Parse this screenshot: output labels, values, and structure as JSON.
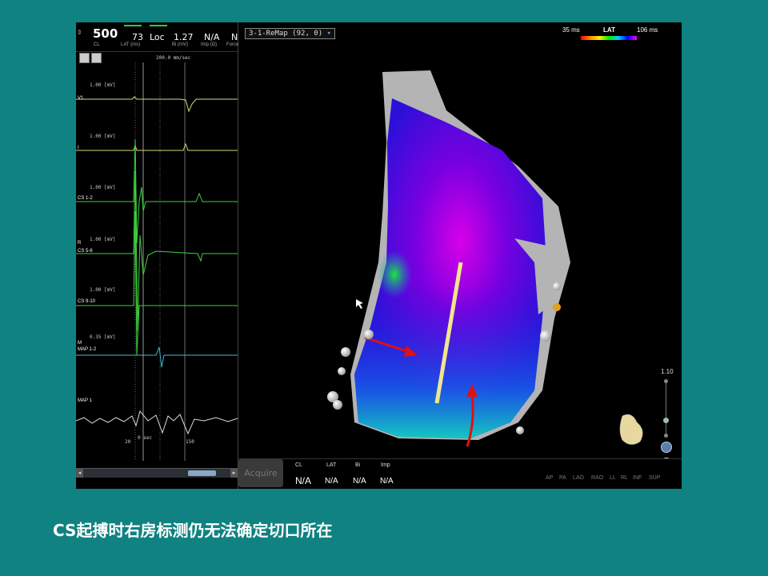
{
  "status_bar": {
    "cl_value": "500",
    "cl_label": "CL",
    "lat_value": "73",
    "lat_label": "LAT (ms)",
    "loc_label": "Loc",
    "bi_value": "1.27",
    "bi_label": "Bi (mV)",
    "imp_value": "N/A",
    "imp_label": "Imp (Ω)",
    "force_value": "N",
    "force_label": "Force"
  },
  "ecg": {
    "sweep_speed": "200.0 mm/sec",
    "channels": [
      {
        "name": "V1",
        "scale": "1.00 [mV]"
      },
      {
        "name": "I",
        "scale": "1.00 [mV]"
      },
      {
        "name": "CS 1-2",
        "scale": "1.00 [mV]"
      },
      {
        "name": "CS 5-6",
        "scale": "1.00 [mV]",
        "marker": "R"
      },
      {
        "name": "CS 9-10",
        "scale": "1.00 [mV]"
      },
      {
        "name": "MAP 1-2",
        "scale": "0.35 [mV]",
        "marker": "M"
      },
      {
        "name": "MAP 1",
        "scale": ""
      }
    ],
    "time_labels": {
      "left": "20",
      "zero": "0 sec",
      "right": "150"
    }
  },
  "map": {
    "title": "3-1-ReMap (92, 0)",
    "lat_legend": {
      "label": "LAT",
      "min": "35 ms",
      "max": "106 ms"
    },
    "zoom_value": "1.10"
  },
  "bottom_panel": {
    "acquire_label": "Acquire",
    "columns": [
      {
        "header": "CL",
        "value": "N/A"
      },
      {
        "header": "LAT",
        "value": "N/A"
      },
      {
        "header": "Bi",
        "value": "N/A"
      },
      {
        "header": "Imp",
        "value": "N/A"
      }
    ],
    "views": [
      "AP",
      "PA",
      "LAO",
      "RAO",
      "LL",
      "RL",
      "INF",
      "SUP"
    ]
  },
  "caption": "CS起搏时右房标测仍无法确定切口所在",
  "colors": {
    "slide_background": "#0f8281",
    "arrow": "#e01010",
    "line_marker": "#f0e68c"
  }
}
